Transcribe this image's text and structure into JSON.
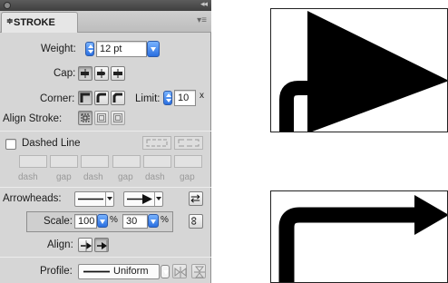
{
  "panel": {
    "collapse_glyph": "◂◂",
    "tab_arrows": "≑",
    "tab_title": "STROKE",
    "tab_close": "▾",
    "menu_glyph": "▾≡",
    "weight_label": "Weight:",
    "weight_value": "12 pt",
    "cap_label": "Cap:",
    "corner_label": "Corner:",
    "limit_label": "Limit:",
    "limit_value": "10",
    "limit_unit": "x",
    "align_stroke_label": "Align Stroke:",
    "dashed_line_label": "Dashed Line",
    "dash_gap_labels": [
      "dash",
      "gap",
      "dash",
      "gap",
      "dash",
      "gap"
    ],
    "arrowheads_label": "Arrowheads:",
    "scale_label": "Scale:",
    "scale_start": "100",
    "scale_end": "30",
    "percent_sign": "%",
    "align_label": "Align:",
    "profile_label": "Profile:",
    "profile_value": "Uniform"
  },
  "icons": {
    "swap": "⇄",
    "link": "∞"
  },
  "colors": {
    "accent_blue": "#2a6fe0",
    "panel_bg": "#d6d6d6",
    "artwork": "#000000"
  }
}
